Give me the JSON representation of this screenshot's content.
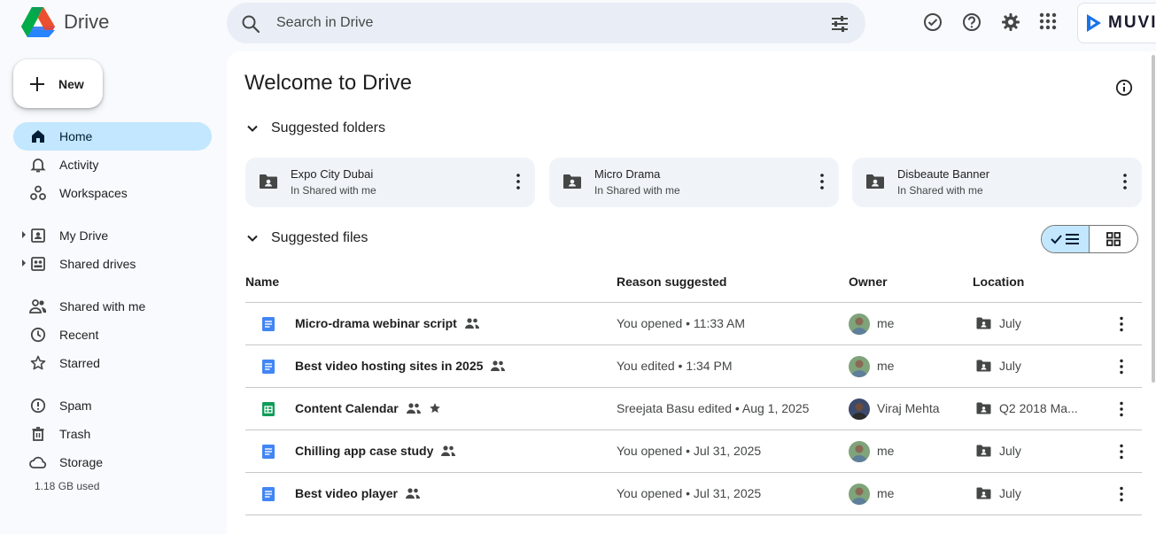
{
  "app": {
    "name": "Drive"
  },
  "search": {
    "placeholder": "Search in Drive"
  },
  "brand": {
    "text": "MUVI"
  },
  "nav": {
    "new_label": "New",
    "items": [
      {
        "label": "Home",
        "icon": "home-icon",
        "active": true
      },
      {
        "label": "Activity",
        "icon": "bell-icon"
      },
      {
        "label": "Workspaces",
        "icon": "workspaces-icon"
      },
      {
        "label": "My Drive",
        "icon": "my-drive-icon"
      },
      {
        "label": "Shared drives",
        "icon": "shared-drives-icon"
      },
      {
        "label": "Shared with me",
        "icon": "people-icon"
      },
      {
        "label": "Recent",
        "icon": "clock-icon"
      },
      {
        "label": "Starred",
        "icon": "star-icon"
      },
      {
        "label": "Spam",
        "icon": "spam-icon"
      },
      {
        "label": "Trash",
        "icon": "trash-icon"
      },
      {
        "label": "Storage",
        "icon": "cloud-icon"
      }
    ],
    "storage_used": "1.18 GB used"
  },
  "main": {
    "title": "Welcome to Drive",
    "suggested_folders_label": "Suggested folders",
    "suggested_files_label": "Suggested files",
    "folders": [
      {
        "name": "Expo City Dubai",
        "location": "In Shared with me"
      },
      {
        "name": "Micro Drama",
        "location": "In Shared with me"
      },
      {
        "name": "Disbeaute Banner",
        "location": "In Shared with me"
      }
    ],
    "columns": {
      "name": "Name",
      "reason": "Reason suggested",
      "owner": "Owner",
      "location": "Location"
    },
    "files": [
      {
        "name": "Micro-drama webinar script",
        "type": "doc",
        "shared": true,
        "starred": false,
        "reason": "You opened • 11:33 AM",
        "owner": "me",
        "location": "July"
      },
      {
        "name": "Best video hosting sites in 2025",
        "type": "doc",
        "shared": true,
        "starred": false,
        "reason": "You edited • 1:34 PM",
        "owner": "me",
        "location": "July"
      },
      {
        "name": "Content Calendar",
        "type": "sheet",
        "shared": true,
        "starred": true,
        "reason": "Sreejata Basu edited • Aug 1, 2025",
        "owner": "Viraj Mehta",
        "location": "Q2 2018 Ma..."
      },
      {
        "name": "Chilling app case study",
        "type": "doc",
        "shared": true,
        "starred": false,
        "reason": "You opened • Jul 31, 2025",
        "owner": "me",
        "location": "July"
      },
      {
        "name": "Best video player",
        "type": "doc",
        "shared": true,
        "starred": false,
        "reason": "You opened • Jul 31, 2025",
        "owner": "me",
        "location": "July"
      }
    ]
  },
  "colors": {
    "accent": "#c2e7ff",
    "doc_blue": "#4285f4",
    "sheet_green": "#0f9d58"
  }
}
